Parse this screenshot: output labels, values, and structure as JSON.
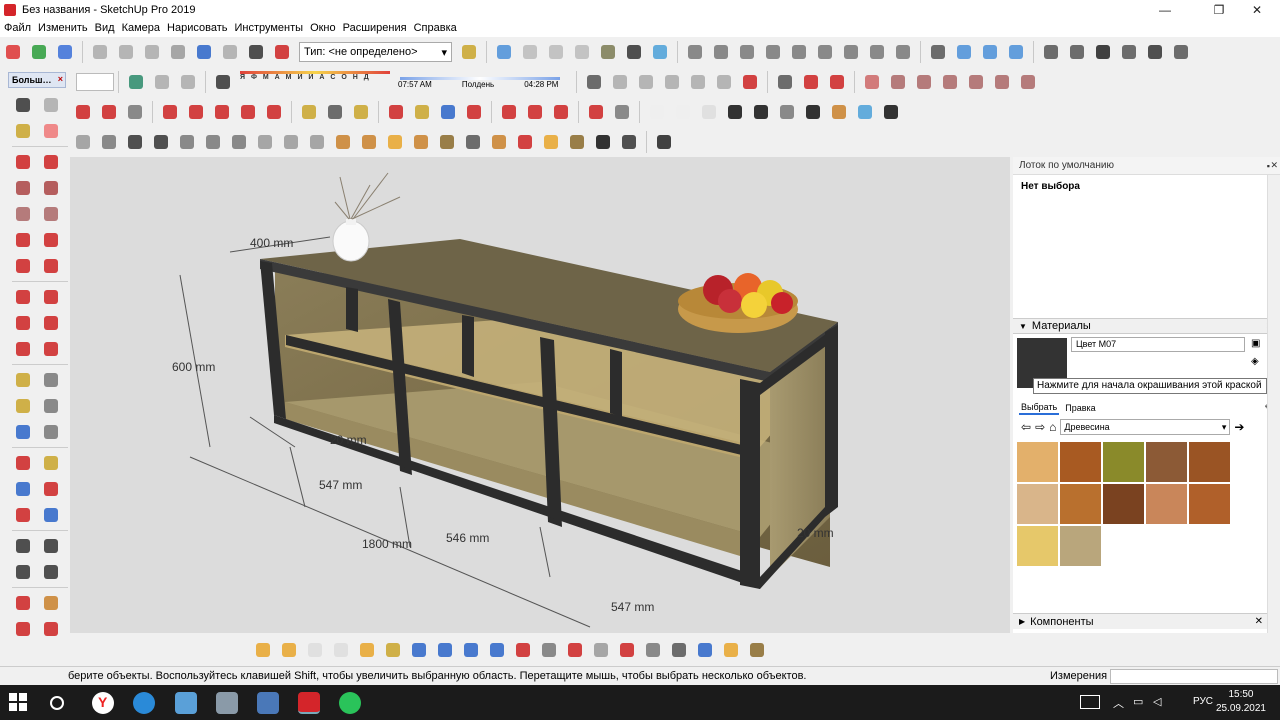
{
  "window": {
    "title": "Без названия - SketchUp Pro 2019",
    "min_icon": "minimize-icon",
    "max_icon": "maximize-icon",
    "close_icon": "close-icon"
  },
  "menu": [
    "Файл",
    "Изменить",
    "Вид",
    "Камера",
    "Нарисовать",
    "Инструменты",
    "Окно",
    "Расширения",
    "Справка"
  ],
  "toolbar": {
    "type_label": "Тип: <не определено>",
    "shadow_months": "Я Ф М А М И И А С О Н Д",
    "sunrise": "07:57 AM",
    "noon": "Полдень",
    "sunset": "04:28 PM"
  },
  "left_panel": {
    "tab_label": "Больш…"
  },
  "viewport": {
    "dimensions": {
      "d400": "400 mm",
      "d600": "600 mm",
      "d20a": "20 mm",
      "d547a": "547 mm",
      "d1800": "1800 mm",
      "d546": "546 mm",
      "d547b": "547 mm",
      "d20b": "20 mm"
    }
  },
  "tray": {
    "title": "Лоток по умолчанию",
    "selection": "Нет выбора",
    "materials_header": "Материалы",
    "material_name": "Цвет M07",
    "tooltip": "Нажмите для начала окрашивания этой краской",
    "tab_select": "Выбрать",
    "tab_edit": "Правка",
    "category": "Древесина",
    "components_header": "Компоненты",
    "swatches": [
      "#e3b06b",
      "#a85a22",
      "#8a8a2a",
      "#8c5a36",
      "#9a5424",
      "#d9b58a",
      "#b9702e",
      "#7a4220",
      "#c9865a",
      "#b0602a",
      "#e6c86a",
      "#b9a67c"
    ]
  },
  "status": {
    "hint": "берите объекты. Воспользуйтесь клавишей Shift, чтобы увеличить выбранную область. Перетащите мышь, чтобы выбрать несколько объектов.",
    "measure_label": "Измерения"
  },
  "taskbar": {
    "time": "15:50",
    "date": "25.09.2021",
    "lang": "РУС"
  }
}
